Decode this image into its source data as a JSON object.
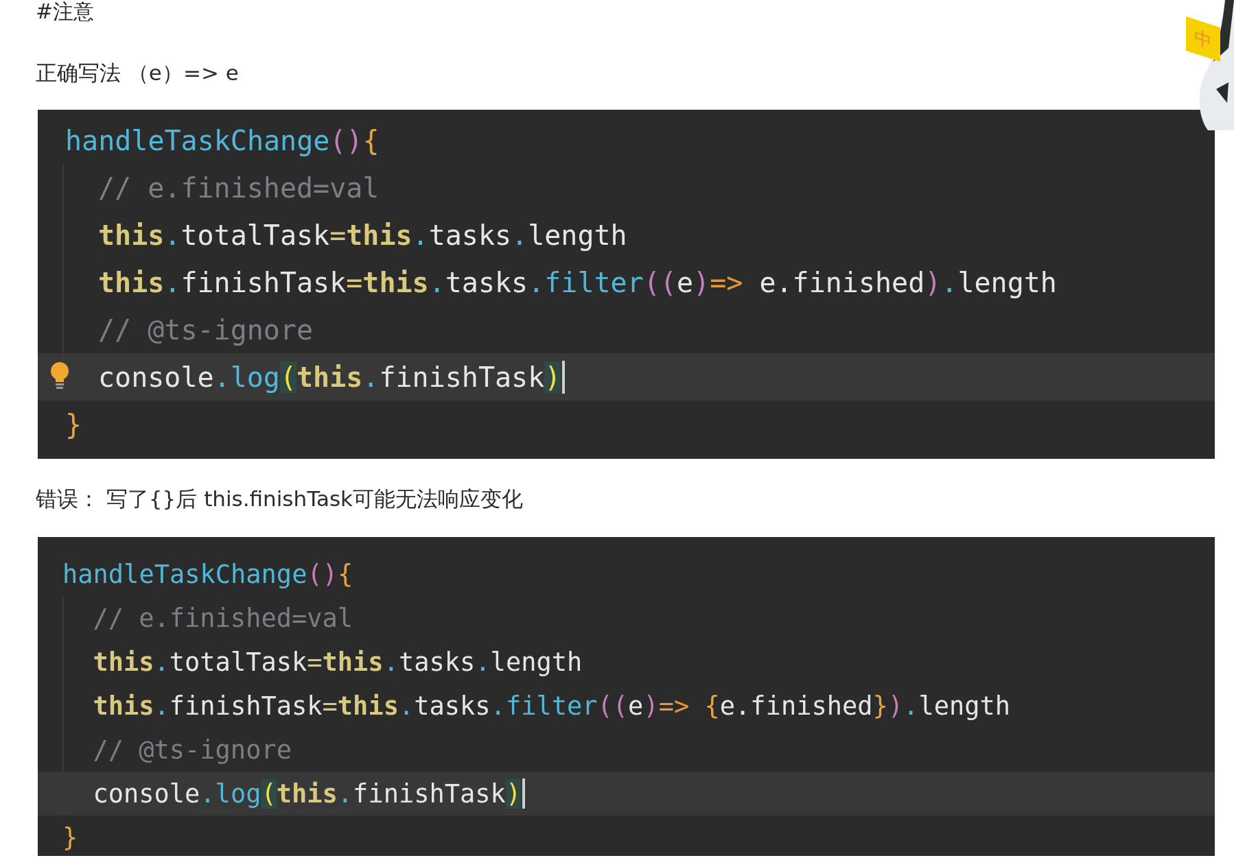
{
  "heading": "#注意",
  "correct_note": "正确写法 （e）=> e",
  "ime_badge": "中",
  "blocks": [
    {
      "lines": [
        {
          "indented": false,
          "current": false,
          "lightbulb": false,
          "caret": false,
          "tokens": [
            {
              "kind": "fn",
              "text": "handleTaskChange"
            },
            {
              "kind": "paren",
              "text": "()"
            },
            {
              "kind": "brace",
              "text": "{"
            }
          ]
        },
        {
          "indented": true,
          "current": false,
          "lightbulb": false,
          "caret": false,
          "tokens": [
            {
              "kind": "comment",
              "text": "// e.finished=val"
            }
          ]
        },
        {
          "indented": true,
          "current": false,
          "lightbulb": false,
          "caret": false,
          "tokens": [
            {
              "kind": "this",
              "text": "this"
            },
            {
              "kind": "punct",
              "text": "."
            },
            {
              "kind": "plain",
              "text": "totalTask"
            },
            {
              "kind": "op",
              "text": "="
            },
            {
              "kind": "this",
              "text": "this"
            },
            {
              "kind": "punct",
              "text": "."
            },
            {
              "kind": "plain",
              "text": "tasks"
            },
            {
              "kind": "punct",
              "text": "."
            },
            {
              "kind": "plain",
              "text": "length"
            }
          ]
        },
        {
          "indented": true,
          "current": false,
          "lightbulb": false,
          "caret": false,
          "tokens": [
            {
              "kind": "this",
              "text": "this"
            },
            {
              "kind": "punct",
              "text": "."
            },
            {
              "kind": "plain",
              "text": "finishTask"
            },
            {
              "kind": "op",
              "text": "="
            },
            {
              "kind": "this",
              "text": "this"
            },
            {
              "kind": "punct",
              "text": "."
            },
            {
              "kind": "plain",
              "text": "tasks"
            },
            {
              "kind": "punct",
              "text": "."
            },
            {
              "kind": "fn",
              "text": "filter"
            },
            {
              "kind": "paren",
              "text": "(("
            },
            {
              "kind": "plain",
              "text": "e"
            },
            {
              "kind": "paren",
              "text": ")"
            },
            {
              "kind": "arrow",
              "text": "=>"
            },
            {
              "kind": "plain",
              "text": " e.finished"
            },
            {
              "kind": "paren",
              "text": ")"
            },
            {
              "kind": "punct",
              "text": "."
            },
            {
              "kind": "plain",
              "text": "length"
            }
          ]
        },
        {
          "indented": true,
          "current": false,
          "lightbulb": false,
          "caret": false,
          "tokens": [
            {
              "kind": "comment",
              "text": "// @ts-ignore"
            }
          ]
        },
        {
          "indented": true,
          "current": true,
          "lightbulb": true,
          "caret": true,
          "tokens": [
            {
              "kind": "plain",
              "text": "console"
            },
            {
              "kind": "punct",
              "text": "."
            },
            {
              "kind": "fn",
              "text": "log"
            },
            {
              "kind": "match",
              "text": "("
            },
            {
              "kind": "this",
              "text": "this"
            },
            {
              "kind": "punct",
              "text": "."
            },
            {
              "kind": "plain",
              "text": "finishTask"
            },
            {
              "kind": "match",
              "text": ")"
            }
          ]
        },
        {
          "indented": false,
          "current": false,
          "lightbulb": false,
          "caret": false,
          "tokens": [
            {
              "kind": "brace",
              "text": "}"
            }
          ]
        }
      ]
    },
    {
      "lines": [
        {
          "indented": false,
          "current": false,
          "lightbulb": false,
          "caret": false,
          "tokens": [
            {
              "kind": "fn",
              "text": "handleTaskChange"
            },
            {
              "kind": "paren",
              "text": "()"
            },
            {
              "kind": "brace",
              "text": "{"
            }
          ]
        },
        {
          "indented": true,
          "current": false,
          "lightbulb": false,
          "caret": false,
          "tokens": [
            {
              "kind": "comment",
              "text": "// e.finished=val"
            }
          ]
        },
        {
          "indented": true,
          "current": false,
          "lightbulb": false,
          "caret": false,
          "tokens": [
            {
              "kind": "this",
              "text": "this"
            },
            {
              "kind": "punct",
              "text": "."
            },
            {
              "kind": "plain",
              "text": "totalTask"
            },
            {
              "kind": "op",
              "text": "="
            },
            {
              "kind": "this",
              "text": "this"
            },
            {
              "kind": "punct",
              "text": "."
            },
            {
              "kind": "plain",
              "text": "tasks"
            },
            {
              "kind": "punct",
              "text": "."
            },
            {
              "kind": "plain",
              "text": "length"
            }
          ]
        },
        {
          "indented": true,
          "current": false,
          "lightbulb": false,
          "caret": false,
          "tokens": [
            {
              "kind": "this",
              "text": "this"
            },
            {
              "kind": "punct",
              "text": "."
            },
            {
              "kind": "plain",
              "text": "finishTask"
            },
            {
              "kind": "op",
              "text": "="
            },
            {
              "kind": "this",
              "text": "this"
            },
            {
              "kind": "punct",
              "text": "."
            },
            {
              "kind": "plain",
              "text": "tasks"
            },
            {
              "kind": "punct",
              "text": "."
            },
            {
              "kind": "fn",
              "text": "filter"
            },
            {
              "kind": "paren",
              "text": "(("
            },
            {
              "kind": "plain",
              "text": "e"
            },
            {
              "kind": "paren",
              "text": ")"
            },
            {
              "kind": "arrow",
              "text": "=> "
            },
            {
              "kind": "brace",
              "text": "{"
            },
            {
              "kind": "plain",
              "text": "e.finished"
            },
            {
              "kind": "brace",
              "text": "}"
            },
            {
              "kind": "paren",
              "text": ")"
            },
            {
              "kind": "punct",
              "text": "."
            },
            {
              "kind": "plain",
              "text": "length"
            }
          ]
        },
        {
          "indented": true,
          "current": false,
          "lightbulb": false,
          "caret": false,
          "tokens": [
            {
              "kind": "comment",
              "text": "// @ts-ignore"
            }
          ]
        },
        {
          "indented": true,
          "current": true,
          "lightbulb": false,
          "caret": true,
          "tokens": [
            {
              "kind": "plain",
              "text": "console"
            },
            {
              "kind": "punct",
              "text": "."
            },
            {
              "kind": "fn",
              "text": "log"
            },
            {
              "kind": "match",
              "text": "("
            },
            {
              "kind": "this",
              "text": "this"
            },
            {
              "kind": "punct",
              "text": "."
            },
            {
              "kind": "plain",
              "text": "finishTask"
            },
            {
              "kind": "match",
              "text": ")"
            }
          ]
        },
        {
          "indented": false,
          "current": false,
          "lightbulb": false,
          "caret": false,
          "tokens": [
            {
              "kind": "brace",
              "text": "}"
            }
          ]
        }
      ]
    }
  ],
  "wrong_note": "错误： 写了{}后   this.finishTask可能无法响应变化"
}
